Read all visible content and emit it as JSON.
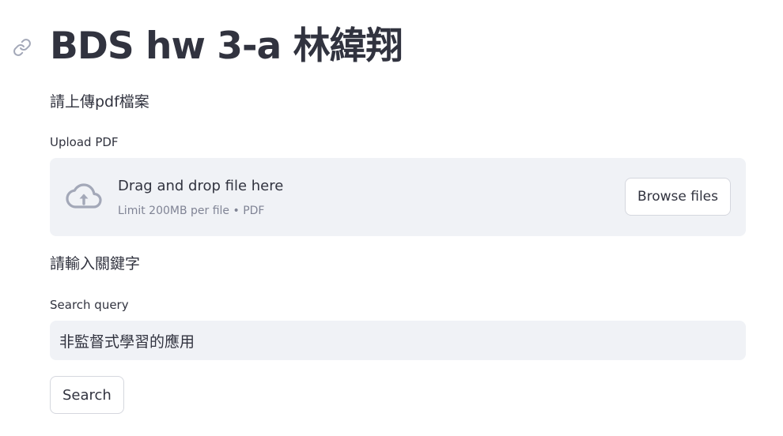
{
  "header": {
    "title": "BDS hw 3-a 林緯翔",
    "anchor_icon": "link-icon"
  },
  "upload_section": {
    "caption": "請上傳pdf檔案",
    "label": "Upload PDF",
    "dropzone": {
      "icon": "cloud-upload-icon",
      "title": "Drag and drop file here",
      "subtitle": "Limit 200MB per file • PDF",
      "browse_label": "Browse files"
    }
  },
  "search_section": {
    "caption": "請輸入關鍵字",
    "label": "Search query",
    "input_value": "非監督式學習的應用",
    "button_label": "Search"
  },
  "colors": {
    "text": "#31333f",
    "muted_text": "#808495",
    "widget_bg": "#f0f2f6",
    "icon": "#a3a8b8",
    "border": "#d5d7de"
  }
}
